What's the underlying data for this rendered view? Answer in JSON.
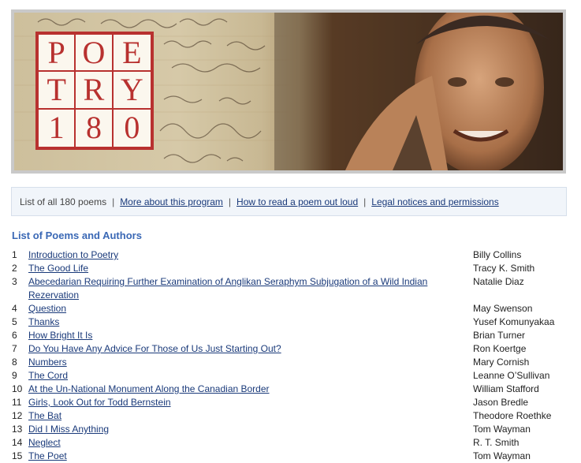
{
  "banner": {
    "logo_letters": [
      "P",
      "O",
      "E",
      "T",
      "R",
      "Y",
      "1",
      "8",
      "0"
    ],
    "colors": {
      "logo_red": "#b8312f",
      "logo_bg": "#fbf7ee",
      "frame": "#c9c9c9"
    }
  },
  "nav": {
    "intro_text": "List of all 180 poems",
    "separator": "|",
    "links": [
      "More about this program",
      "How to read a poem out loud",
      "Legal notices and permissions"
    ]
  },
  "section_title": "List of Poems and Authors",
  "poems": [
    {
      "num": "1",
      "title": "Introduction to Poetry",
      "author": "Billy Collins"
    },
    {
      "num": "2",
      "title": "The Good Life",
      "author": "Tracy K. Smith"
    },
    {
      "num": "3",
      "title": "Abecedarian Requiring Further Examination of Anglikan Seraphym Subjugation of a Wild Indian Rezervation",
      "author": "Natalie Diaz"
    },
    {
      "num": "4",
      "title": "Question",
      "author": "May Swenson"
    },
    {
      "num": "5",
      "title": "Thanks",
      "author": "Yusef Komunyakaa"
    },
    {
      "num": "6",
      "title": "How Bright It Is",
      "author": "Brian Turner"
    },
    {
      "num": "7",
      "title": "Do You Have Any Advice For Those of Us Just Starting Out?",
      "author": "Ron Koertge"
    },
    {
      "num": "8",
      "title": "Numbers",
      "author": "Mary Cornish"
    },
    {
      "num": "9",
      "title": "The Cord",
      "author": "Leanne O’Sullivan"
    },
    {
      "num": "10",
      "title": "At the Un-National Monument Along the Canadian Border",
      "author": "William Stafford"
    },
    {
      "num": "11",
      "title": "Girls, Look Out for Todd Bernstein",
      "author": "Jason Bredle"
    },
    {
      "num": "12",
      "title": "The Bat",
      "author": "Theodore Roethke"
    },
    {
      "num": "13",
      "title": "Did I Miss Anything",
      "author": "Tom Wayman"
    },
    {
      "num": "14",
      "title": "Neglect",
      "author": "R. T. Smith"
    },
    {
      "num": "15",
      "title": "The Poet",
      "author": "Tom Wayman"
    }
  ]
}
